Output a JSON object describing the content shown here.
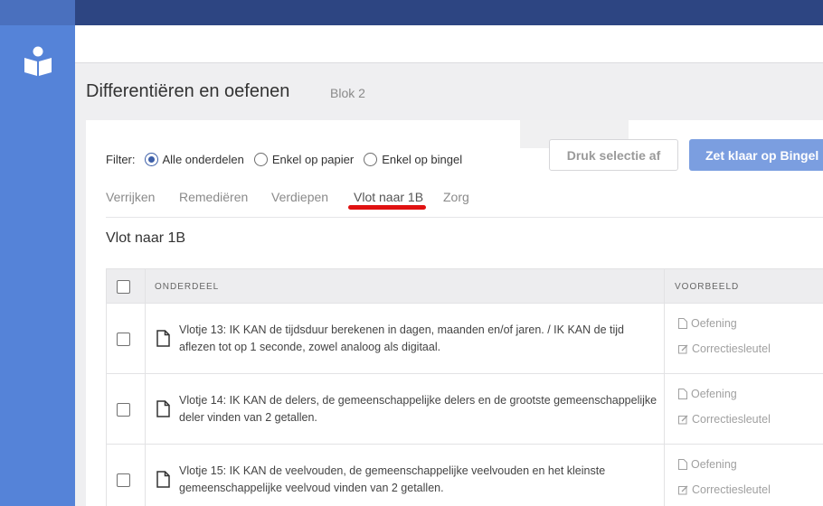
{
  "page": {
    "title": "Differentiëren en oefenen",
    "subtitle": "Blok 2"
  },
  "filter": {
    "label": "Filter:",
    "options": [
      "Alle onderdelen",
      "Enkel op papier",
      "Enkel op bingel"
    ],
    "selected": "Alle onderdelen"
  },
  "actions": {
    "print_label": "Druk selectie af",
    "bingel_label": "Zet klaar op Bingel"
  },
  "tabs": [
    {
      "label": "Verrijken"
    },
    {
      "label": "Remediëren"
    },
    {
      "label": "Verdiepen"
    },
    {
      "label": "Vlot naar 1B",
      "active": true
    },
    {
      "label": "Zorg"
    }
  ],
  "section": {
    "title": "Vlot naar 1B"
  },
  "table": {
    "columns": [
      "ONDERDEEL",
      "VOORBEELD"
    ],
    "rows": [
      {
        "text": "Vlotje 13: IK KAN de tijdsduur berekenen in dagen, maanden en/of jaren. / IK KAN de tijd aflezen tot op 1 seconde, zowel analoog als digitaal.",
        "links": [
          "Oefening",
          "Correctiesleutel"
        ]
      },
      {
        "text": "Vlotje 14: IK KAN de delers, de gemeenschappelijke delers en de grootste gemeenschappelijke deler vinden van 2 getallen.",
        "links": [
          "Oefening",
          "Correctiesleutel"
        ]
      },
      {
        "text": "Vlotje 15: IK KAN de veelvouden, de gemeenschappelijke veelvouden en het kleinste gemeenschappelijke veelvoud vinden van 2 getallen.",
        "links": [
          "Oefening",
          "Correctiesleutel"
        ]
      }
    ]
  },
  "colors": {
    "sidebar": "#5583d8",
    "topbar": "#2d4582",
    "accent": "#3d5fa8",
    "primary_button": "#7b9ee0",
    "tab_marker": "#e01111"
  },
  "icons": {
    "logo": "reader-book-icon",
    "document": "document-icon",
    "edit": "edit-square-icon"
  }
}
